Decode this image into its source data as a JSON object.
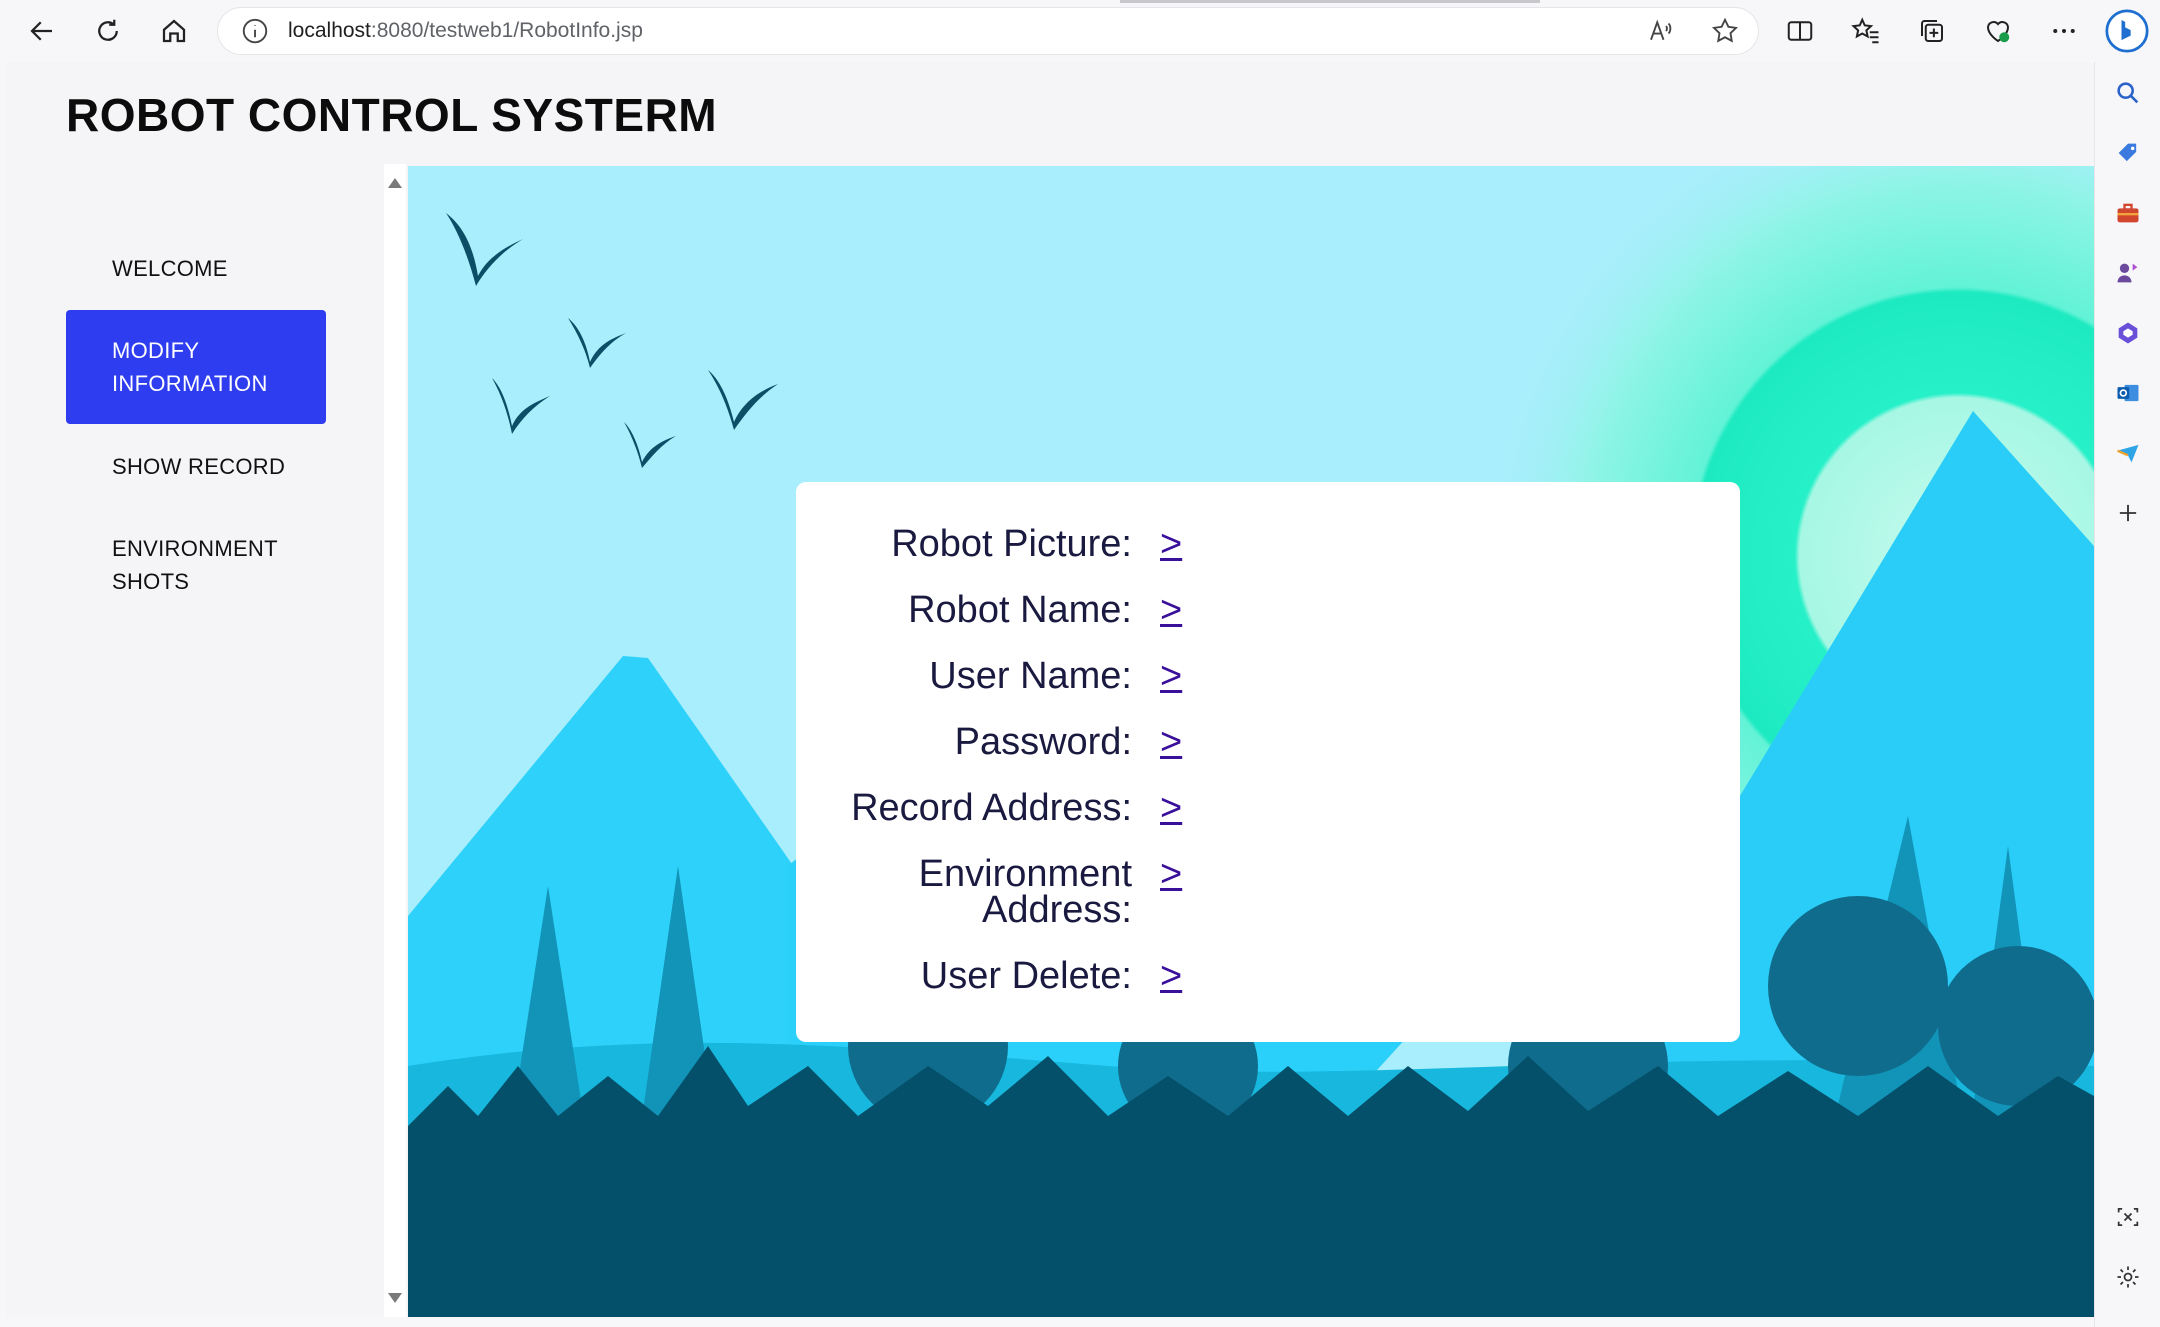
{
  "browser": {
    "url_host": "localhost",
    "url_rest": ":8080/testweb1/RobotInfo.jsp"
  },
  "app": {
    "title": "ROBOT CONTROL SYSTERM"
  },
  "nav": {
    "welcome": "WELCOME",
    "modify_line1": "MODIFY",
    "modify_line2": "INFORMATION",
    "show_record": "SHOW RECORD",
    "env_line1": "ENVIRONMENT",
    "env_line2": "SHOTS"
  },
  "info": {
    "link_text": ">",
    "rows": [
      {
        "label": "Robot Picture:"
      },
      {
        "label": "Robot Name:"
      },
      {
        "label": "User Name:"
      },
      {
        "label": "Password:"
      },
      {
        "label": "Record Address:"
      },
      {
        "label_line1": "Environment",
        "label_line2": "Address:"
      },
      {
        "label": "User Delete:"
      }
    ]
  },
  "colors": {
    "accent": "#2e3df0",
    "sky": "#a9eefc",
    "forest": "#04506a"
  }
}
